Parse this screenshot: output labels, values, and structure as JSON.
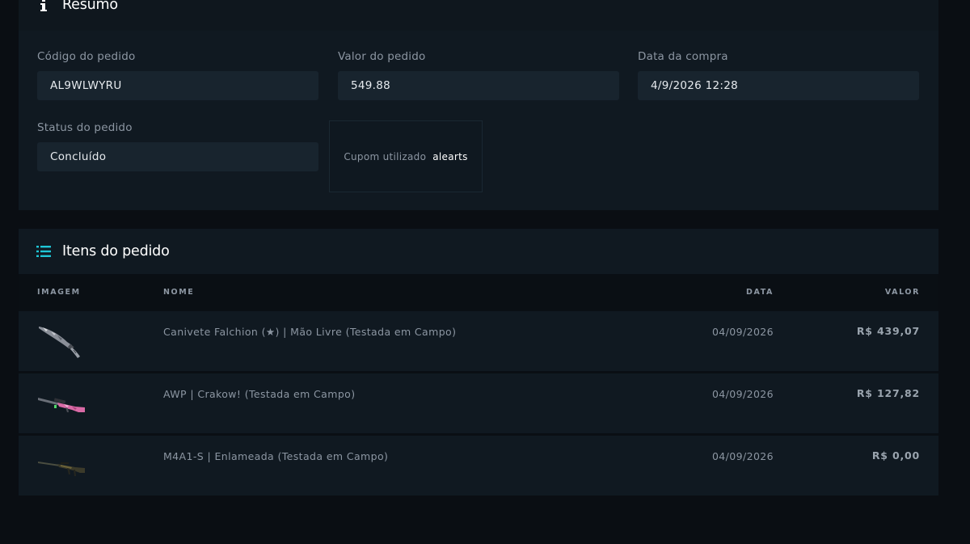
{
  "summary": {
    "title": "Resumo",
    "order_code_label": "Código do pedido",
    "order_code_value": "AL9WLWYRU",
    "order_value_label": "Valor do pedido",
    "order_value_value": "549.88",
    "purchase_date_label": "Data da compra",
    "purchase_date_value": "4/9/2026 12:28",
    "status_label": "Status do pedido",
    "status_value": "Concluído",
    "coupon_label": "Cupom utilizado",
    "coupon_value": "alearts"
  },
  "items": {
    "title": "Itens do pedido",
    "columns": {
      "image": "IMAGEM",
      "name": "NOME",
      "date": "DATA",
      "value": "VALOR"
    },
    "rows": [
      {
        "name": "Canivete Falchion (★) | Mão Livre (Testada em Campo)",
        "date": "04/09/2026",
        "price": "R$ 439,07",
        "icon": "falchion-knife-icon"
      },
      {
        "name": "AWP | Crakow! (Testada em Campo)",
        "date": "04/09/2026",
        "price": "R$ 127,82",
        "icon": "awp-rifle-icon"
      },
      {
        "name": "M4A1-S | Enlameada (Testada em Campo)",
        "date": "04/09/2026",
        "price": "R$ 0,00",
        "icon": "m4a1s-rifle-icon"
      }
    ]
  },
  "colors": {
    "accent": "#1fc6d6",
    "background": "#0a0e13",
    "panel": "#101921",
    "field": "#18242e"
  }
}
